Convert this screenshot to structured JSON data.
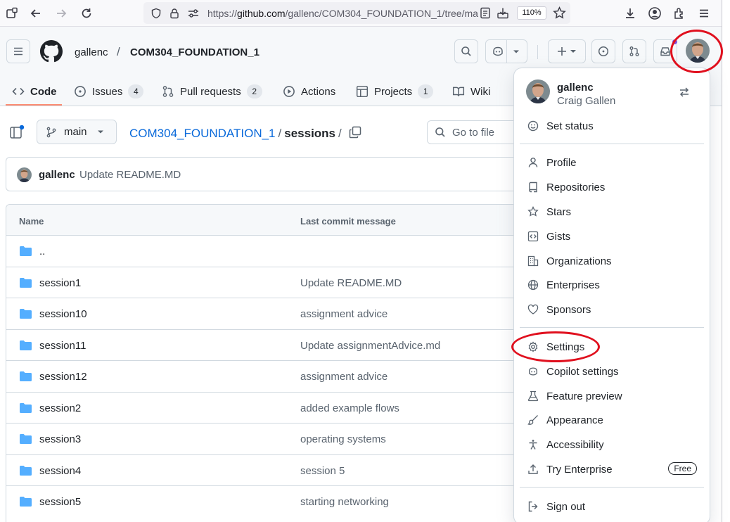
{
  "browser": {
    "url_prefix": "https://",
    "url_domain": "github.com",
    "url_path": "/gallenc/COM304_FOUNDATION_1/tree/ma",
    "zoom": "110%"
  },
  "header": {
    "owner": "gallenc",
    "separator": "/",
    "repo": "COM304_FOUNDATION_1"
  },
  "tabs": [
    {
      "label": "Code"
    },
    {
      "label": "Issues",
      "count": "4"
    },
    {
      "label": "Pull requests",
      "count": "2"
    },
    {
      "label": "Actions"
    },
    {
      "label": "Projects",
      "count": "1"
    },
    {
      "label": "Wiki"
    }
  ],
  "repo_nav": {
    "branch": "main",
    "breadcrumb_repo": "COM304_FOUNDATION_1",
    "breadcrumb_sep": "/",
    "breadcrumb_dir": "sessions",
    "breadcrumb_trail": "/",
    "goto_placeholder": "Go to file"
  },
  "latest_commit": {
    "user": "gallenc",
    "message": "Update README.MD"
  },
  "file_table": {
    "headers": {
      "name": "Name",
      "message": "Last commit message"
    },
    "rows": [
      {
        "name": "..",
        "message": ""
      },
      {
        "name": "session1",
        "message": "Update README.MD"
      },
      {
        "name": "session10",
        "message": "assignment advice"
      },
      {
        "name": "session11",
        "message": "Update assignmentAdvice.md"
      },
      {
        "name": "session12",
        "message": "assignment advice"
      },
      {
        "name": "session2",
        "message": "added example flows"
      },
      {
        "name": "session3",
        "message": "operating systems"
      },
      {
        "name": "session4",
        "message": "session 5"
      },
      {
        "name": "session5",
        "message": "starting networking"
      }
    ]
  },
  "user_menu": {
    "login": "gallenc",
    "full_name": "Craig Gallen",
    "set_status": "Set status",
    "profile": "Profile",
    "repositories": "Repositories",
    "stars": "Stars",
    "gists": "Gists",
    "organizations": "Organizations",
    "enterprises": "Enterprises",
    "sponsors": "Sponsors",
    "settings": "Settings",
    "copilot_settings": "Copilot settings",
    "feature_preview": "Feature preview",
    "appearance": "Appearance",
    "accessibility": "Accessibility",
    "try_enterprise": "Try Enterprise",
    "free_badge": "Free",
    "sign_out": "Sign out"
  },
  "colors": {
    "link": "#0969da",
    "folder": "#54aeff",
    "tab_underline": "#fd8c73",
    "annotation": "#e0101e",
    "notification_dot": "#8250df"
  }
}
